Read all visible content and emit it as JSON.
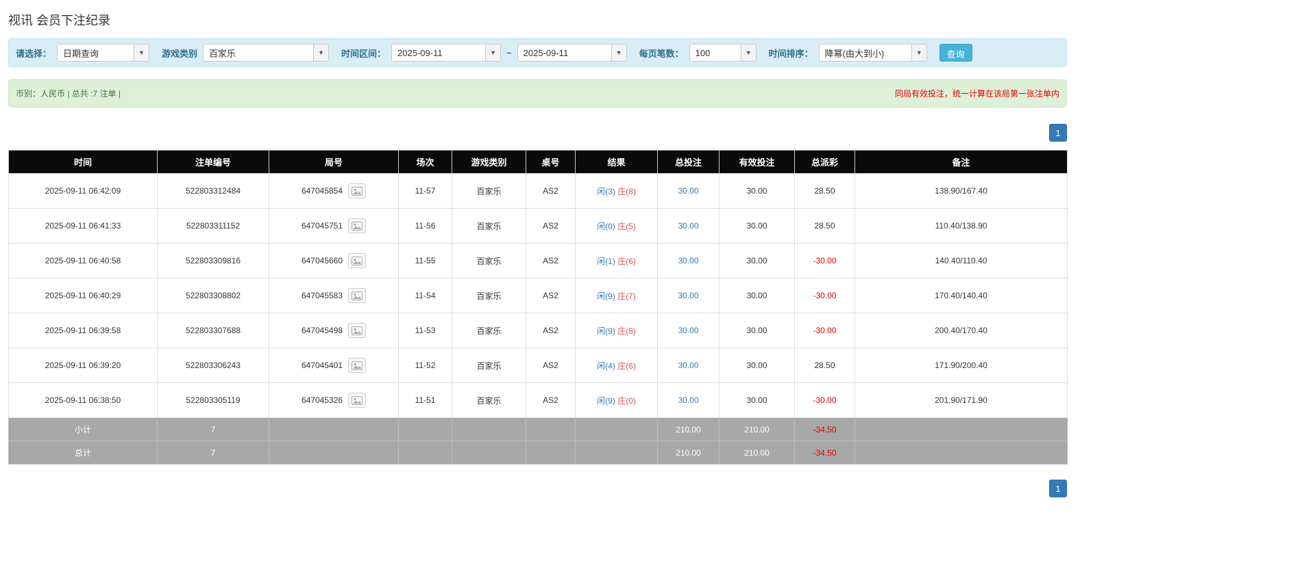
{
  "page": {
    "title": "视讯 会员下注纪录"
  },
  "filters": {
    "select_label": "请选择：",
    "select_value": "日期查询",
    "game_type_label": "游戏类别",
    "game_type_value": "百家乐",
    "date_range_label": "时间区间：",
    "date_from": "2025-09-11",
    "date_separator": "~",
    "date_to": "2025-09-11",
    "page_size_label": "每页笔数：",
    "page_size_value": "100",
    "sort_label": "时间排序：",
    "sort_value": "降幂(由大到小)",
    "search_button": "查询"
  },
  "summary": {
    "left_text": "币别：人民币 | 总共 :7 注单 |",
    "right_note": "同局有效投注，统一计算在该局第一张注单内"
  },
  "pagination": {
    "page": "1"
  },
  "table": {
    "headers": [
      "时间",
      "注单编号",
      "局号",
      "场次",
      "游戏类别",
      "桌号",
      "结果",
      "总投注",
      "有效投注",
      "总派彩",
      "备注"
    ],
    "rows": [
      {
        "time": "2025-09-11 06:42:09",
        "bet_id": "522803312484",
        "round_id": "647045854",
        "session": "11-57",
        "game_type": "百家乐",
        "table_no": "AS2",
        "result_player": "闲(3)",
        "result_banker": "庄(8)",
        "total_bet": "30.00",
        "valid_bet": "30.00",
        "payout": "28.50",
        "remark": "138.90/167.40"
      },
      {
        "time": "2025-09-11 06:41:33",
        "bet_id": "522803311152",
        "round_id": "647045751",
        "session": "11-56",
        "game_type": "百家乐",
        "table_no": "AS2",
        "result_player": "闲(0)",
        "result_banker": "庄(5)",
        "total_bet": "30.00",
        "valid_bet": "30.00",
        "payout": "28.50",
        "remark": "110.40/138.90"
      },
      {
        "time": "2025-09-11 06:40:58",
        "bet_id": "522803309816",
        "round_id": "647045660",
        "session": "11-55",
        "game_type": "百家乐",
        "table_no": "AS2",
        "result_player": "闲(1)",
        "result_banker": "庄(6)",
        "total_bet": "30.00",
        "valid_bet": "30.00",
        "payout": "-30.00",
        "remark": "140.40/110.40"
      },
      {
        "time": "2025-09-11 06:40:29",
        "bet_id": "522803308802",
        "round_id": "647045583",
        "session": "11-54",
        "game_type": "百家乐",
        "table_no": "AS2",
        "result_player": "闲(9)",
        "result_banker": "庄(7)",
        "total_bet": "30.00",
        "valid_bet": "30.00",
        "payout": "-30.00",
        "remark": "170.40/140.40"
      },
      {
        "time": "2025-09-11 06:39:58",
        "bet_id": "522803307688",
        "round_id": "647045498",
        "session": "11-53",
        "game_type": "百家乐",
        "table_no": "AS2",
        "result_player": "闲(9)",
        "result_banker": "庄(8)",
        "total_bet": "30.00",
        "valid_bet": "30.00",
        "payout": "-30.00",
        "remark": "200.40/170.40"
      },
      {
        "time": "2025-09-11 06:39:20",
        "bet_id": "522803306243",
        "round_id": "647045401",
        "session": "11-52",
        "game_type": "百家乐",
        "table_no": "AS2",
        "result_player": "闲(4)",
        "result_banker": "庄(6)",
        "total_bet": "30.00",
        "valid_bet": "30.00",
        "payout": "28.50",
        "remark": "171.90/200.40"
      },
      {
        "time": "2025-09-11 06:38:50",
        "bet_id": "522803305119",
        "round_id": "647045326",
        "session": "11-51",
        "game_type": "百家乐",
        "table_no": "AS2",
        "result_player": "闲(9)",
        "result_banker": "庄(0)",
        "total_bet": "30.00",
        "valid_bet": "30.00",
        "payout": "-30.00",
        "remark": "201.90/171.90"
      }
    ],
    "subtotal": {
      "label": "小计",
      "count": "7",
      "total_bet": "210.00",
      "valid_bet": "210.00",
      "payout": "-34.50"
    },
    "total": {
      "label": "总计",
      "count": "7",
      "total_bet": "210.00",
      "valid_bet": "210.00",
      "payout": "-34.50"
    }
  }
}
